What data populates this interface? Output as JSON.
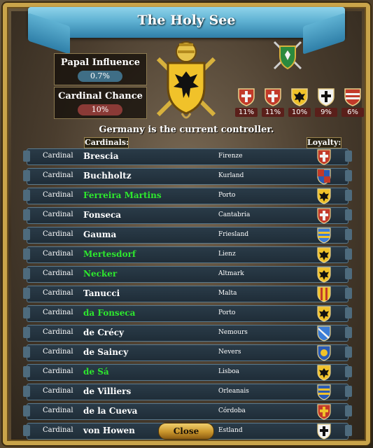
{
  "window": {
    "title": "The Holy See"
  },
  "papal_influence": {
    "label": "Papal Influence",
    "value": "0.7%"
  },
  "cardinal_chance": {
    "label": "Cardinal Chance",
    "value": "10%"
  },
  "controller_text": "Germany is the current controller.",
  "headers": {
    "cardinals": "Cardinals:",
    "loyalty": "Loyalty:"
  },
  "candidates": [
    {
      "pct": "11%",
      "colors": [
        "#c23a2a",
        "#f2f2f2"
      ],
      "icon": "cross-shield-icon"
    },
    {
      "pct": "11%",
      "colors": [
        "#c23a2a",
        "#f2f2f2"
      ],
      "icon": "cross-shield-icon"
    },
    {
      "pct": "10%",
      "colors": [
        "#f0c22a",
        "#111111"
      ],
      "icon": "eagle-shield-icon"
    },
    {
      "pct": "9%",
      "colors": [
        "#f2f2f2",
        "#111111"
      ],
      "icon": "cross-shield-icon"
    },
    {
      "pct": "6%",
      "colors": [
        "#c23a2a",
        "#f2f2f2"
      ],
      "icon": "bars-shield-icon"
    }
  ],
  "cardinals": [
    {
      "role": "Cardinal",
      "name": "Brescia",
      "province": "Firenze",
      "highlight": false,
      "loyalty": {
        "icon": "cross-shield-icon",
        "colors": [
          "#c23a2a",
          "#f2f2f2"
        ]
      }
    },
    {
      "role": "Cardinal",
      "name": "Buchholtz",
      "province": "Kurland",
      "highlight": false,
      "loyalty": {
        "icon": "quartered-shield-icon",
        "colors": [
          "#2a5bb5",
          "#c23a2a"
        ]
      }
    },
    {
      "role": "Cardinal",
      "name": "Ferreira Martins",
      "province": "Porto",
      "highlight": true,
      "loyalty": {
        "icon": "eagle-shield-icon",
        "colors": [
          "#f0c22a",
          "#111111"
        ]
      }
    },
    {
      "role": "Cardinal",
      "name": "Fonseca",
      "province": "Cantabria",
      "highlight": false,
      "loyalty": {
        "icon": "cross-shield-icon",
        "colors": [
          "#c23a2a",
          "#f2f2f2"
        ]
      }
    },
    {
      "role": "Cardinal",
      "name": "Gauma",
      "province": "Friesland",
      "highlight": false,
      "loyalty": {
        "icon": "bars-shield-icon",
        "colors": [
          "#3b7cd6",
          "#f0c22a"
        ]
      }
    },
    {
      "role": "Cardinal",
      "name": "Mertesdorf",
      "province": "Lienz",
      "highlight": true,
      "loyalty": {
        "icon": "eagle-shield-icon",
        "colors": [
          "#f0c22a",
          "#111111"
        ]
      }
    },
    {
      "role": "Cardinal",
      "name": "Necker",
      "province": "Altmark",
      "highlight": true,
      "loyalty": {
        "icon": "eagle-shield-icon",
        "colors": [
          "#f0c22a",
          "#111111"
        ]
      }
    },
    {
      "role": "Cardinal",
      "name": "Tanucci",
      "province": "Malta",
      "highlight": false,
      "loyalty": {
        "icon": "stripes-shield-icon",
        "colors": [
          "#f0c22a",
          "#c23a2a"
        ]
      }
    },
    {
      "role": "Cardinal",
      "name": "da Fonseca",
      "province": "Porto",
      "highlight": true,
      "loyalty": {
        "icon": "eagle-shield-icon",
        "colors": [
          "#f0c22a",
          "#111111"
        ]
      }
    },
    {
      "role": "Cardinal",
      "name": "de Crécy",
      "province": "Nemours",
      "highlight": false,
      "loyalty": {
        "icon": "diagonal-shield-icon",
        "colors": [
          "#3b7cd6",
          "#f2f2f2"
        ]
      }
    },
    {
      "role": "Cardinal",
      "name": "de Saincy",
      "province": "Nevers",
      "highlight": false,
      "loyalty": {
        "icon": "lion-shield-icon",
        "colors": [
          "#2a5bb5",
          "#f0c22a"
        ]
      }
    },
    {
      "role": "Cardinal",
      "name": "de Sá",
      "province": "Lisboa",
      "highlight": true,
      "loyalty": {
        "icon": "eagle-shield-icon",
        "colors": [
          "#f0c22a",
          "#111111"
        ]
      }
    },
    {
      "role": "Cardinal",
      "name": "de Villiers",
      "province": "Orleanais",
      "highlight": false,
      "loyalty": {
        "icon": "bars-shield-icon",
        "colors": [
          "#2a5bb5",
          "#f0c22a"
        ]
      }
    },
    {
      "role": "Cardinal",
      "name": "de la Cueva",
      "province": "Córdoba",
      "highlight": false,
      "loyalty": {
        "icon": "cross-shield-icon",
        "colors": [
          "#c23a2a",
          "#f0c22a"
        ]
      }
    },
    {
      "role": "Cardinal",
      "name": "von Howen",
      "province": "Estland",
      "highlight": false,
      "loyalty": {
        "icon": "cross-shield-icon",
        "colors": [
          "#f2f2f2",
          "#111111"
        ]
      }
    }
  ],
  "buttons": {
    "close": "Close"
  },
  "colors": {
    "highlight_name": "#2ee82e",
    "influence_pill": "#3f6e86",
    "chance_pill": "#8a3a36"
  }
}
